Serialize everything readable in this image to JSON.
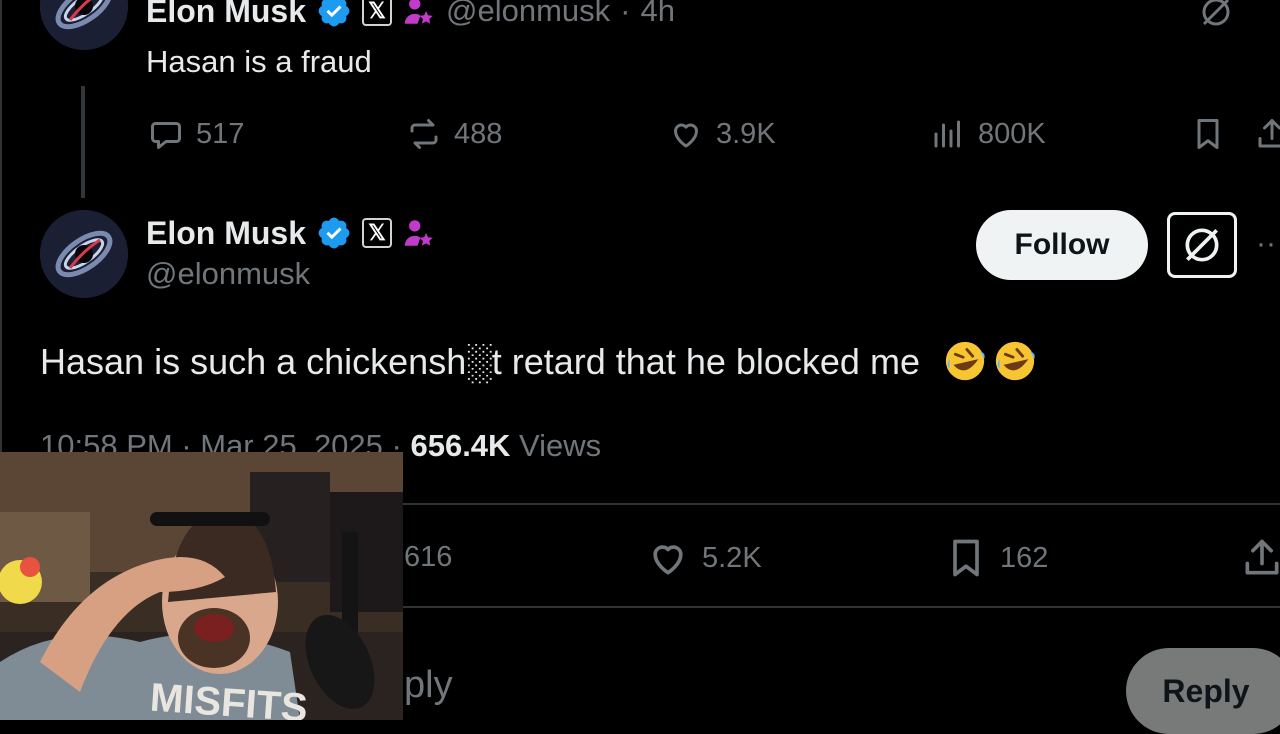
{
  "reply_tweet": {
    "author_name": "Elon Musk",
    "x_badge": "𝕏",
    "handle": "@elonmusk",
    "separator": "·",
    "time_ago": "4h",
    "text": "Hasan is a fraud",
    "stats": {
      "replies": "517",
      "reposts": "488",
      "likes": "3.9K",
      "views": "800K"
    }
  },
  "main_tweet": {
    "author_name": "Elon Musk",
    "x_badge": "𝕏",
    "handle": "@elonmusk",
    "follow_label": "Follow",
    "text": "Hasan is such a chickensh░t retard that he blocked me",
    "meta_time": "10:58 PM · Mar 25, 2025 · ",
    "meta_views_count": "656.4K",
    "meta_views_label": " Views",
    "stats": {
      "replies": "616",
      "likes": "5.2K",
      "bookmarks": "162"
    }
  },
  "reply_bar": {
    "placeholder_fragment": "ply",
    "reply_label": "Reply"
  },
  "colors": {
    "background": "#000000",
    "text_primary": "#e7e9ea",
    "text_secondary": "#71767b",
    "verified_blue": "#1d9bf0",
    "affiliate_pink": "#c13ac9"
  }
}
